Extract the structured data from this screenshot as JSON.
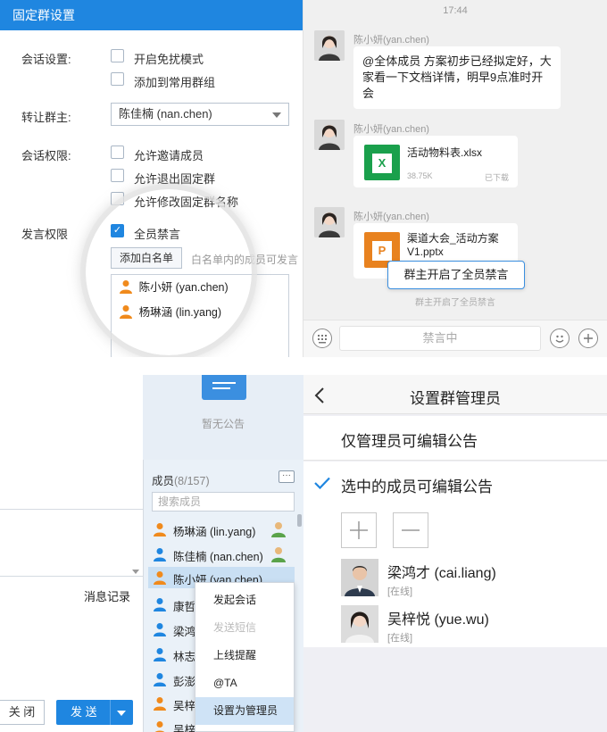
{
  "settings": {
    "title": "固定群设置",
    "conversation_label": "会话设置:",
    "opt_dnd": "开启免扰模式",
    "opt_common": "添加到常用群组",
    "transfer_label": "转让群主:",
    "transfer_value": "陈佳楠 (nan.chen)",
    "permission_label": "会话权限:",
    "perm_invite": "允许邀请成员",
    "perm_exit": "允许退出固定群",
    "perm_rename": "允许修改固定群名称",
    "speak_label": "发言权限",
    "mute_all": "全员禁言",
    "add_whitelist_btn": "添加白名单",
    "whitelist_hint": "白名单内的成员可发言",
    "whitelist": [
      "陈小妍 (yan.chen)",
      "杨琳涵 (lin.yang)"
    ]
  },
  "chat": {
    "time": "17:44",
    "sender": "陈小妍(yan.chen)",
    "message": "@全体成员 方案初步已经拟定好，大家看一下文档详情，明早9点准时开会",
    "file1": {
      "name": "活动物料表.xlsx",
      "size": "38.75K",
      "status": "已下载",
      "icon_text": "X"
    },
    "file2": {
      "name": "渠道大会_活动方案V1.pptx",
      "icon_text": "P"
    },
    "toast": "群主开启了全员禁言",
    "system_note": "群主开启了全员禁言",
    "input_placeholder": "禁言中"
  },
  "members_panel": {
    "notice_empty": "暂无公告",
    "members_label": "成员",
    "members_count": "(8/157)",
    "more": "···",
    "search_placeholder": "搜索成员",
    "members": [
      "杨琳涵 (lin.yang)",
      "陈佳楠 (nan.chen)",
      "陈小妍 (yan.chen)",
      "康哲",
      "梁鸿",
      "林志",
      "彭澎",
      "吴梓",
      "吴梓"
    ],
    "history": "消息记录",
    "close_btn": "关 闭",
    "send_btn": "发 送",
    "context_menu": [
      "发起会话",
      "发送短信",
      "上线提醒",
      "@TA",
      "设置为管理员"
    ]
  },
  "mobile": {
    "title": "设置群管理员",
    "opt_admin_only": "仅管理员可编辑公告",
    "opt_selected": "选中的成员可编辑公告",
    "admins": [
      {
        "name": "梁鸿才 (cai.liang)",
        "status": "[在线]"
      },
      {
        "name": "吴梓悦 (yue.wu)",
        "status": "[在线]"
      }
    ]
  },
  "colors": {
    "accent": "#1f86e0",
    "orange": "#f08a1c",
    "green": "#1aa04c",
    "ppt": "#e8821f"
  }
}
